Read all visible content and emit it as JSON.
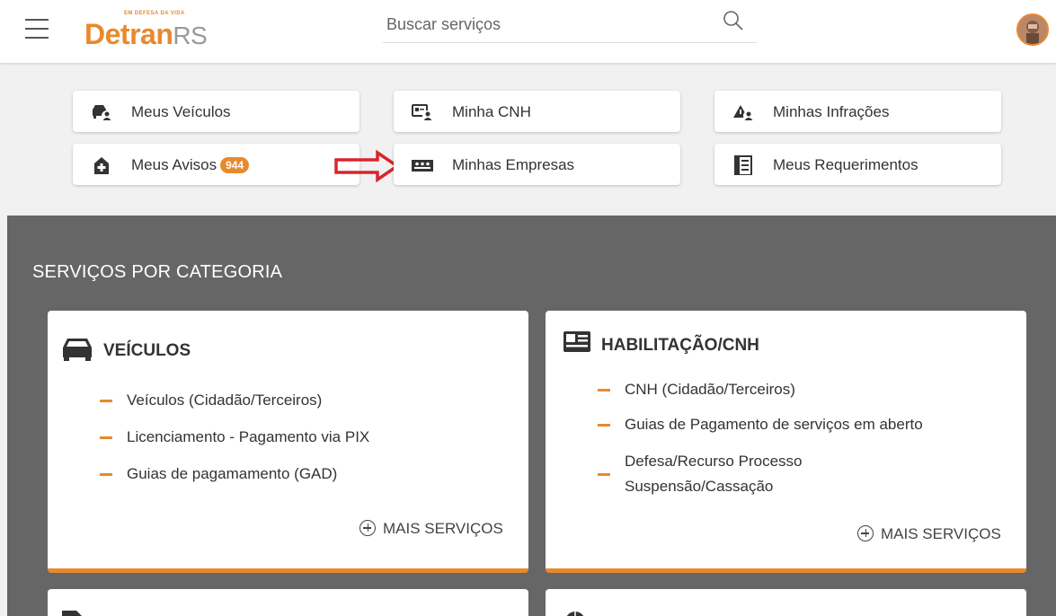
{
  "header": {
    "logo_tagline": "EM DEFESA DA VIDA",
    "logo_d": "D",
    "logo_etran": "etran",
    "logo_rs": "RS",
    "search_placeholder": "Buscar serviços"
  },
  "quick_links": {
    "meus_veiculos": "Meus Veículos",
    "minha_cnh": "Minha CNH",
    "minhas_infracoes": "Minhas Infrações",
    "meus_avisos": "Meus Avisos",
    "meus_avisos_badge": "944",
    "minhas_empresas": "Minhas Empresas",
    "meus_requerimentos": "Meus Requerimentos"
  },
  "section": {
    "title": "SERVIÇOS POR CATEGORIA"
  },
  "cards": {
    "veiculos": {
      "title": "VEÍCULOS",
      "items": [
        "Veículos (Cidadão/Terceiros)",
        "Licenciamento - Pagamento via PIX",
        "Guias de pagamamento (GAD)"
      ],
      "more": "MAIS SERVIÇOS"
    },
    "habilitacao": {
      "title": "HABILITAÇÃO/CNH",
      "items": [
        "CNH (Cidadão/Terceiros)",
        "Guias de Pagamento de serviços em aberto",
        "Defesa/Recurso Processo",
        "Suspensão/Cassação"
      ],
      "more": "MAIS SERVIÇOS"
    }
  },
  "colors": {
    "accent": "#e8892e",
    "dark_bg": "#666666",
    "arrow": "#d9242b"
  }
}
